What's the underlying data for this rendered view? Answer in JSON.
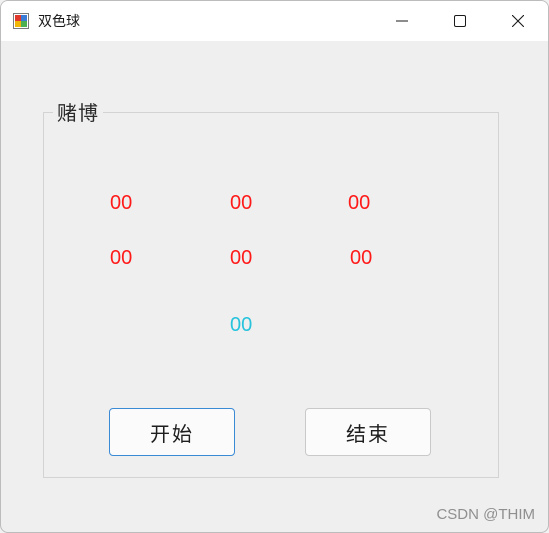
{
  "window": {
    "title": "双色球",
    "controls": [
      "minimize-icon",
      "maximize-icon",
      "close-icon"
    ]
  },
  "group": {
    "title": "赌博"
  },
  "red_balls": [
    "00",
    "00",
    "00",
    "00",
    "00",
    "00"
  ],
  "blue_ball": "00",
  "buttons": {
    "start_label": "开始",
    "end_label": "结束"
  },
  "watermark": "CSDN @THIM",
  "colors": {
    "red_ball": "#ff1a1a",
    "blue_ball": "#27c3dd",
    "primary_border": "#3b8ad6"
  }
}
